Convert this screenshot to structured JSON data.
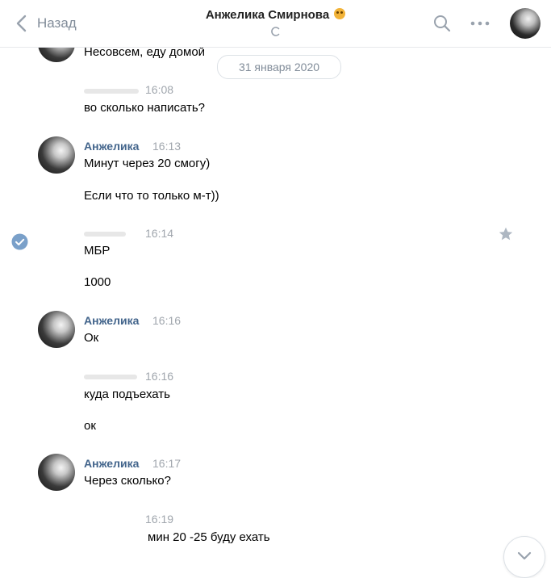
{
  "header": {
    "back_label": "Назад",
    "title": "Анжелика Смирнова"
  },
  "date_separator": "31 января 2020",
  "messages": [
    {
      "text": "Несовсем, еду домой"
    },
    {
      "time": "16:08",
      "text": "во сколько написать?"
    },
    {
      "author": "Анжелика",
      "time": "16:13",
      "lines": [
        "Минут через 20 смогу)",
        "Если что то только м-т))"
      ]
    },
    {
      "time": "16:14",
      "lines": [
        "МБР",
        "1000"
      ]
    },
    {
      "author": "Анжелика",
      "time": "16:16",
      "text": "Ок"
    },
    {
      "time": "16:16",
      "lines": [
        "куда подъехать",
        "ок"
      ]
    },
    {
      "author": "Анжелика",
      "time": "16:17",
      "text": "Через сколько?"
    },
    {
      "time": "16:19",
      "text": "мин 20 -25 буду ехать"
    }
  ],
  "colors": {
    "author": "#42648b",
    "time": "#a0a6ad",
    "accent": "#5181b8"
  }
}
